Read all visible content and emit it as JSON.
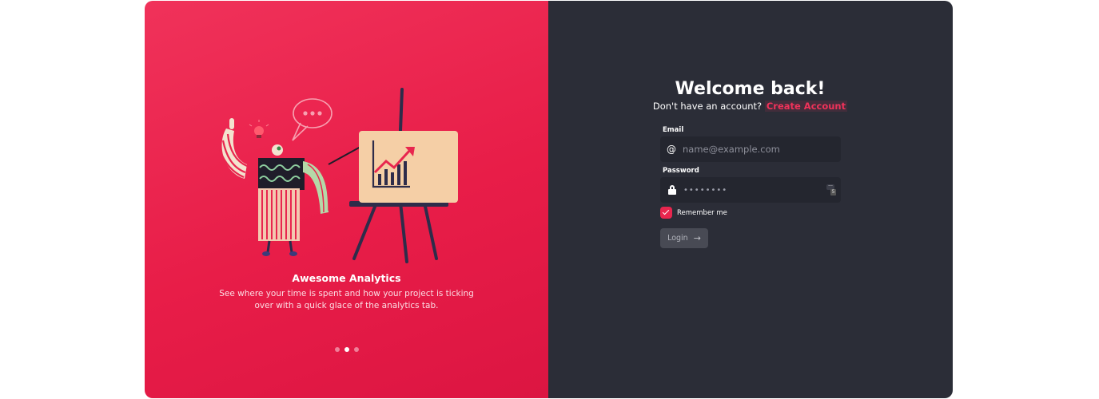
{
  "slide": {
    "title": "Awesome Analytics",
    "description": "See where your time is spent and how your project is ticking over with a quick glace of the analytics tab.",
    "dots": 3,
    "active_dot": 2
  },
  "login": {
    "heading": "Welcome back!",
    "signup_prompt": "Don't have an account?",
    "signup_link": "Create Account",
    "email_label": "Email",
    "email_icon": "@",
    "email_placeholder": "name@example.com",
    "password_label": "Password",
    "password_mask": "••••••••",
    "password_manager_badge": "5",
    "remember_label": "Remember me",
    "remember_checked": true,
    "login_button": "Login",
    "login_arrow": "→"
  },
  "colors": {
    "accent": "#f0325a",
    "panel_dark": "#2b2d37",
    "input_bg": "#24262f"
  }
}
